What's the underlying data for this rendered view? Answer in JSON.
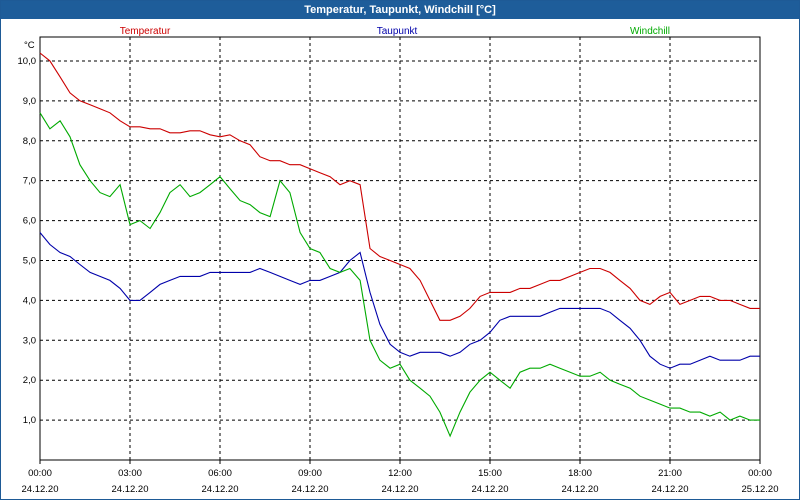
{
  "chart_data": {
    "type": "line",
    "title": "Temperatur, Taupunkt, Windchill [°C]",
    "ylabel": "°C",
    "ylim": [
      0,
      10.6
    ],
    "yticks": [
      "1,0",
      "2,0",
      "3,0",
      "4,0",
      "5,0",
      "6,0",
      "7,0",
      "8,0",
      "9,0",
      "10,0"
    ],
    "xlim": [
      0,
      24
    ],
    "xticks": [
      {
        "time": "00:00",
        "date": "24.12.20"
      },
      {
        "time": "03:00",
        "date": "24.12.20"
      },
      {
        "time": "06:00",
        "date": "24.12.20"
      },
      {
        "time": "09:00",
        "date": "24.12.20"
      },
      {
        "time": "12:00",
        "date": "24.12.20"
      },
      {
        "time": "15:00",
        "date": "24.12.20"
      },
      {
        "time": "18:00",
        "date": "24.12.20"
      },
      {
        "time": "21:00",
        "date": "24.12.20"
      },
      {
        "time": "00:00",
        "date": "25.12.20"
      }
    ],
    "grid": true,
    "legend_position": "top",
    "series": [
      {
        "name": "Temperatur",
        "color": "#cc0000",
        "x": [
          0,
          0.33,
          0.67,
          1,
          1.33,
          1.67,
          2,
          2.33,
          2.67,
          3,
          3.33,
          3.67,
          4,
          4.33,
          4.67,
          5,
          5.33,
          5.67,
          6,
          6.33,
          6.67,
          7,
          7.33,
          7.67,
          8,
          8.33,
          8.67,
          9,
          9.33,
          9.67,
          10,
          10.33,
          10.67,
          11,
          11.33,
          11.67,
          12,
          12.33,
          12.67,
          13,
          13.33,
          13.67,
          14,
          14.33,
          14.67,
          15,
          15.33,
          15.67,
          16,
          16.33,
          16.67,
          17,
          17.33,
          17.67,
          18,
          18.33,
          18.67,
          19,
          19.33,
          19.67,
          20,
          20.33,
          20.67,
          21,
          21.33,
          21.67,
          22,
          22.33,
          22.67,
          23,
          23.33,
          23.67,
          24
        ],
        "values": [
          10.2,
          10.0,
          9.6,
          9.2,
          9.0,
          8.9,
          8.8,
          8.7,
          8.5,
          8.35,
          8.35,
          8.3,
          8.3,
          8.2,
          8.2,
          8.25,
          8.25,
          8.15,
          8.1,
          8.15,
          8.0,
          7.9,
          7.6,
          7.5,
          7.5,
          7.4,
          7.4,
          7.3,
          7.2,
          7.1,
          6.9,
          7.0,
          6.9,
          5.3,
          5.1,
          5.0,
          4.9,
          4.8,
          4.5,
          4.0,
          3.5,
          3.5,
          3.6,
          3.8,
          4.1,
          4.2,
          4.2,
          4.2,
          4.3,
          4.3,
          4.4,
          4.5,
          4.5,
          4.6,
          4.7,
          4.8,
          4.8,
          4.7,
          4.5,
          4.3,
          4.0,
          3.9,
          4.1,
          4.2,
          3.9,
          4.0,
          4.1,
          4.1,
          4.0,
          4.0,
          3.9,
          3.8,
          3.8
        ]
      },
      {
        "name": "Taupunkt",
        "color": "#0000aa",
        "x": [
          0,
          0.33,
          0.67,
          1,
          1.33,
          1.67,
          2,
          2.33,
          2.67,
          3,
          3.33,
          3.67,
          4,
          4.33,
          4.67,
          5,
          5.33,
          5.67,
          6,
          6.33,
          6.67,
          7,
          7.33,
          7.67,
          8,
          8.33,
          8.67,
          9,
          9.33,
          9.67,
          10,
          10.33,
          10.67,
          11,
          11.33,
          11.67,
          12,
          12.33,
          12.67,
          13,
          13.33,
          13.67,
          14,
          14.33,
          14.67,
          15,
          15.33,
          15.67,
          16,
          16.33,
          16.67,
          17,
          17.33,
          17.67,
          18,
          18.33,
          18.67,
          19,
          19.33,
          19.67,
          20,
          20.33,
          20.67,
          21,
          21.33,
          21.67,
          22,
          22.33,
          22.67,
          23,
          23.33,
          23.67,
          24
        ],
        "values": [
          5.7,
          5.4,
          5.2,
          5.1,
          4.9,
          4.7,
          4.6,
          4.5,
          4.3,
          4.0,
          4.0,
          4.2,
          4.4,
          4.5,
          4.6,
          4.6,
          4.6,
          4.7,
          4.7,
          4.7,
          4.7,
          4.7,
          4.8,
          4.7,
          4.6,
          4.5,
          4.4,
          4.5,
          4.5,
          4.6,
          4.7,
          5.0,
          5.2,
          4.2,
          3.4,
          2.9,
          2.7,
          2.6,
          2.7,
          2.7,
          2.7,
          2.6,
          2.7,
          2.9,
          3.0,
          3.2,
          3.5,
          3.6,
          3.6,
          3.6,
          3.6,
          3.7,
          3.8,
          3.8,
          3.8,
          3.8,
          3.8,
          3.7,
          3.5,
          3.3,
          3.0,
          2.6,
          2.4,
          2.3,
          2.4,
          2.4,
          2.5,
          2.6,
          2.5,
          2.5,
          2.5,
          2.6,
          2.6
        ]
      },
      {
        "name": "Windchill",
        "color": "#00aa00",
        "x": [
          0,
          0.33,
          0.67,
          1,
          1.33,
          1.67,
          2,
          2.33,
          2.67,
          3,
          3.33,
          3.67,
          4,
          4.33,
          4.67,
          5,
          5.33,
          5.67,
          6,
          6.33,
          6.67,
          7,
          7.33,
          7.67,
          8,
          8.33,
          8.67,
          9,
          9.33,
          9.67,
          10,
          10.33,
          10.67,
          11,
          11.33,
          11.67,
          12,
          12.33,
          12.67,
          13,
          13.33,
          13.67,
          14,
          14.33,
          14.67,
          15,
          15.33,
          15.67,
          16,
          16.33,
          16.67,
          17,
          17.33,
          17.67,
          18,
          18.33,
          18.67,
          19,
          19.33,
          19.67,
          20,
          20.33,
          20.67,
          21,
          21.33,
          21.67,
          22,
          22.33,
          22.67,
          23,
          23.33,
          23.67,
          24
        ],
        "values": [
          8.7,
          8.3,
          8.5,
          8.1,
          7.4,
          7.0,
          6.7,
          6.6,
          6.9,
          5.9,
          6.0,
          5.8,
          6.2,
          6.7,
          6.9,
          6.6,
          6.7,
          6.9,
          7.1,
          6.8,
          6.5,
          6.4,
          6.2,
          6.1,
          7.0,
          6.7,
          5.7,
          5.3,
          5.2,
          4.8,
          4.7,
          4.8,
          4.5,
          3.0,
          2.5,
          2.3,
          2.4,
          2.0,
          1.8,
          1.6,
          1.2,
          0.6,
          1.2,
          1.7,
          2.0,
          2.2,
          2.0,
          1.8,
          2.2,
          2.3,
          2.3,
          2.4,
          2.3,
          2.2,
          2.1,
          2.1,
          2.2,
          2.0,
          1.9,
          1.8,
          1.6,
          1.5,
          1.4,
          1.3,
          1.3,
          1.2,
          1.2,
          1.1,
          1.2,
          1.0,
          1.1,
          1.0,
          1.0
        ]
      }
    ]
  }
}
